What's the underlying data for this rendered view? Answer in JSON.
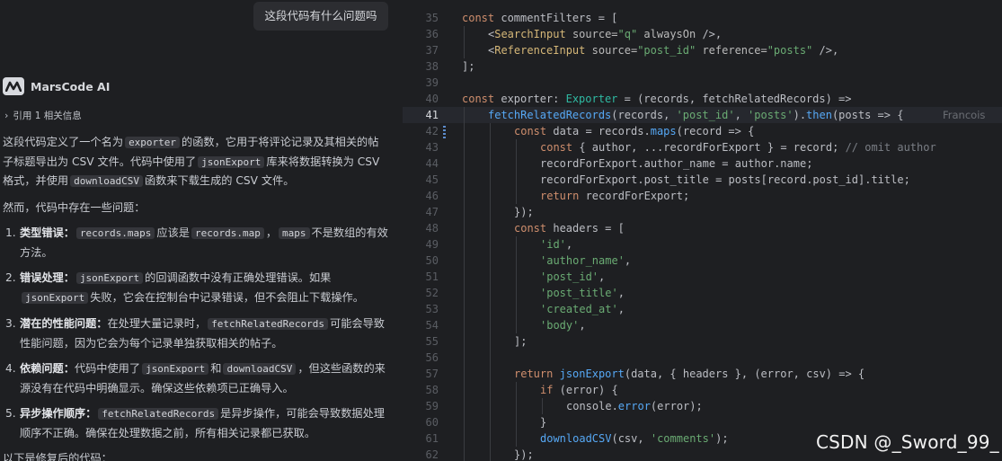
{
  "chat": {
    "user_message": "这段代码有什么问题吗",
    "ai_name": "MarsCode AI",
    "reference_label": "引用 1 相关信息",
    "intro": {
      "t1": "这段代码定义了一个名为",
      "c1": "exporter",
      "t2": "的函数，它用于将评论记录及其相关的帖子标题导出为 CSV 文件。代码中使用了",
      "c2": "jsonExport",
      "t3": "库来将数据转换为 CSV 格式，并使用",
      "c3": "downloadCSV",
      "t4": "函数来下载生成的 CSV 文件。"
    },
    "issues_intro": "然而，代码中存在一些问题：",
    "issues": [
      {
        "num": "1.",
        "title": "类型错误：",
        "t1": "",
        "c1": "records.maps",
        "t2": "应该是",
        "c2": "records.map",
        "t3": "，",
        "c3": "maps",
        "t4": "不是数组的有效方法。"
      },
      {
        "num": "2.",
        "title": "错误处理：",
        "c1": "jsonExport",
        "t2": "的回调函数中没有正确处理错误。如果",
        "c2": "jsonExport",
        "t3": "失败，它会在控制台中记录错误，但不会阻止下载操作。"
      },
      {
        "num": "3.",
        "title": "潜在的性能问题：",
        "t1": "在处理大量记录时，",
        "c1": "fetchRelatedRecords",
        "t2": "可能会导致性能问题，因为它会为每个记录单独获取相关的帖子。"
      },
      {
        "num": "4.",
        "title": "依赖问题：",
        "t1": "代码中使用了",
        "c1": "jsonExport",
        "t2": "和",
        "c2": "downloadCSV",
        "t3": "，但这些函数的来源没有在代码中明确显示。确保这些依赖项已正确导入。"
      },
      {
        "num": "5.",
        "title": "异步操作顺序：",
        "c1": "fetchRelatedRecords",
        "t2": "是异步操作，可能会导致数据处理顺序不正确。确保在处理数据之前，所有相关记录都已获取。"
      }
    ],
    "footer": "以下是修复后的代码："
  },
  "editor": {
    "line_numbers": [
      "35",
      "36",
      "37",
      "38",
      "39",
      "40",
      "41",
      "42",
      "43",
      "44",
      "45",
      "46",
      "47",
      "48",
      "49",
      "50",
      "51",
      "52",
      "53",
      "54",
      "55",
      "56",
      "57",
      "58",
      "59",
      "60",
      "61",
      "62"
    ],
    "blame": "Francois",
    "code": {
      "l35": [
        "const",
        " commentFilters = ["
      ],
      "l36": [
        "<",
        "SearchInput",
        " source=",
        "\"q\"",
        " alwaysOn ",
        "/>,"
      ],
      "l37": [
        "<",
        "ReferenceInput",
        " source=",
        "\"post_id\"",
        " reference=",
        "\"posts\"",
        " />,"
      ],
      "l38": [
        "];"
      ],
      "l40": [
        "const",
        " exporter: ",
        "Exporter",
        " = (records, fetchRelatedRecords) =>"
      ],
      "l41": [
        "fetchRelatedRecords",
        "(records, ",
        "'post_id'",
        ", ",
        "'posts'",
        ").",
        "then",
        "(posts => {"
      ],
      "l42": [
        "const",
        " data = records.",
        "maps",
        "(record => {"
      ],
      "l43": [
        "const",
        " { author, ...recordForExport } = record; ",
        "// omit author"
      ],
      "l44": [
        "recordForExport.author_name = author.name;"
      ],
      "l45": [
        "recordForExport.post_title = posts[record.post_id].title;"
      ],
      "l46": [
        "return",
        " recordForExport;"
      ],
      "l47": [
        "});"
      ],
      "l48": [
        "const",
        " headers = ["
      ],
      "l49": [
        "'id'",
        ","
      ],
      "l50": [
        "'author_name'",
        ","
      ],
      "l51": [
        "'post_id'",
        ","
      ],
      "l52": [
        "'post_title'",
        ","
      ],
      "l53": [
        "'created_at'",
        ","
      ],
      "l54": [
        "'body'",
        ","
      ],
      "l55": [
        "];"
      ],
      "l57": [
        "return",
        " ",
        "jsonExport",
        "(data, { headers }, (error, csv) => {"
      ],
      "l58": [
        "if",
        " (error) {"
      ],
      "l59": [
        "console.",
        "error",
        "(error);"
      ],
      "l60": [
        "}"
      ],
      "l61": [
        "downloadCSV",
        "(csv, ",
        "'comments'",
        ");"
      ],
      "l62": [
        "});"
      ]
    }
  },
  "watermark": "CSDN @_Sword_99_",
  "colors": {
    "background": "#1e1f22",
    "keyword": "#cf8e6d",
    "function": "#56a8f5",
    "string": "#6aab73",
    "type": "#2fbaa3"
  }
}
